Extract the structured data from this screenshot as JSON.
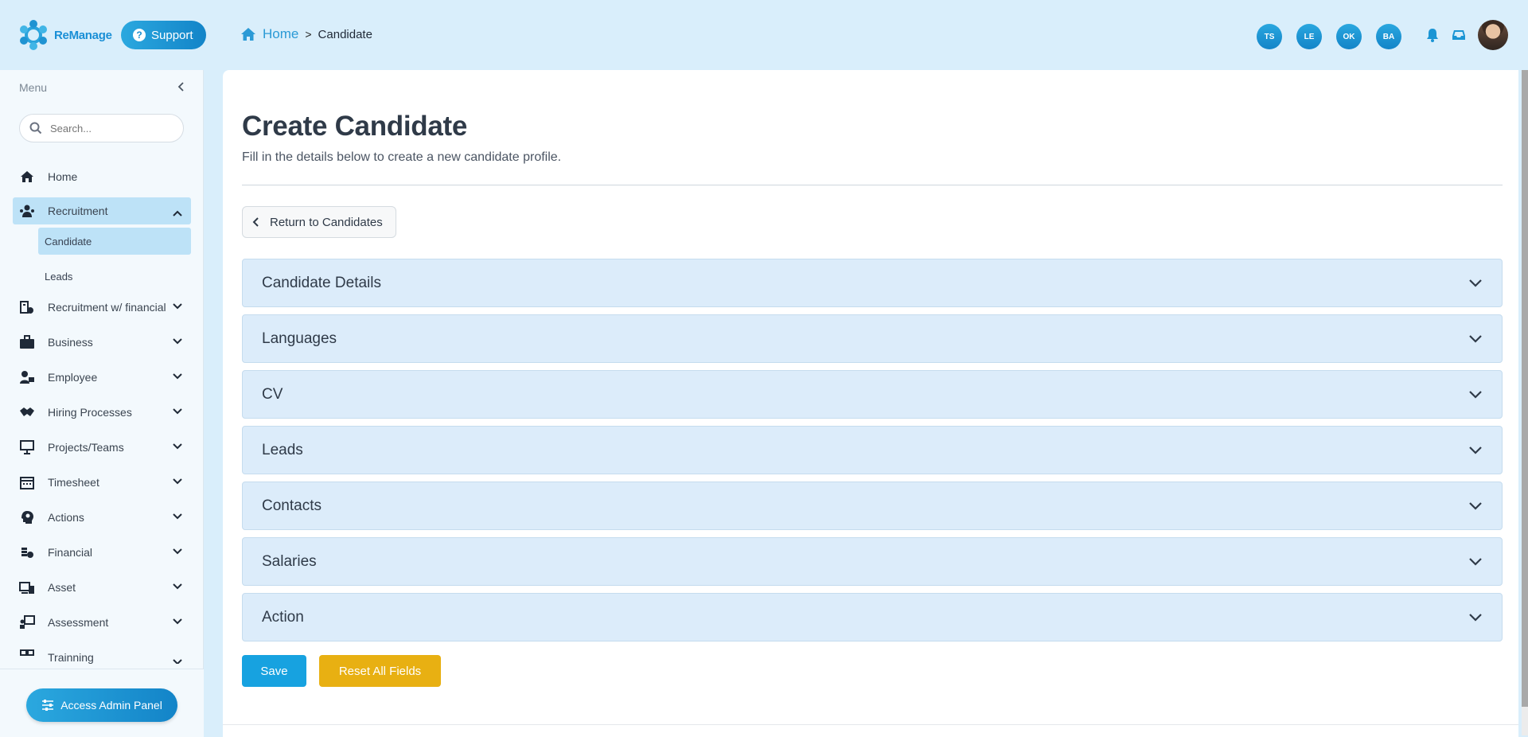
{
  "header": {
    "logo_text": "ReManage",
    "support_label": "Support",
    "breadcrumb": {
      "home": "Home",
      "separator": ">",
      "current": "Candidate"
    },
    "avatars": [
      "TS",
      "LE",
      "OK",
      "BA"
    ]
  },
  "sidebar": {
    "menu_title": "Menu",
    "search_placeholder": "Search...",
    "items": [
      {
        "label": "Home",
        "icon": "home-icon"
      },
      {
        "label": "Recruitment",
        "icon": "people-icon"
      },
      {
        "label": "Recruitment w/ financial",
        "icon": "building-money-icon"
      },
      {
        "label": "Business",
        "icon": "briefcase-icon"
      },
      {
        "label": "Employee",
        "icon": "user-card-icon"
      },
      {
        "label": "Hiring Processes",
        "icon": "handshake-icon"
      },
      {
        "label": "Projects/Teams",
        "icon": "presentation-icon"
      },
      {
        "label": "Timesheet",
        "icon": "calendar-icon"
      },
      {
        "label": "Actions",
        "icon": "head-gear-icon"
      },
      {
        "label": "Financial",
        "icon": "coins-icon"
      },
      {
        "label": "Asset",
        "icon": "devices-icon"
      },
      {
        "label": "Assessment",
        "icon": "teacher-board-icon"
      },
      {
        "label": "Trainning",
        "icon": "training-icon"
      }
    ],
    "sub_items": [
      {
        "label": "Candidate"
      },
      {
        "label": "Leads"
      }
    ],
    "admin_button": "Access Admin Panel"
  },
  "main": {
    "title": "Create Candidate",
    "subtitle": "Fill in the details below to create a new candidate profile.",
    "return_button": "Return to Candidates",
    "sections": [
      "Candidate Details",
      "Languages",
      "CV",
      "Leads",
      "Contacts",
      "Salaries",
      "Action"
    ],
    "save_label": "Save",
    "reset_label": "Reset All Fields"
  },
  "colors": {
    "accent": "#17a2e0",
    "warning": "#e8b012",
    "header_bg": "#d9eefb",
    "accordion_bg": "#dcecfa"
  }
}
